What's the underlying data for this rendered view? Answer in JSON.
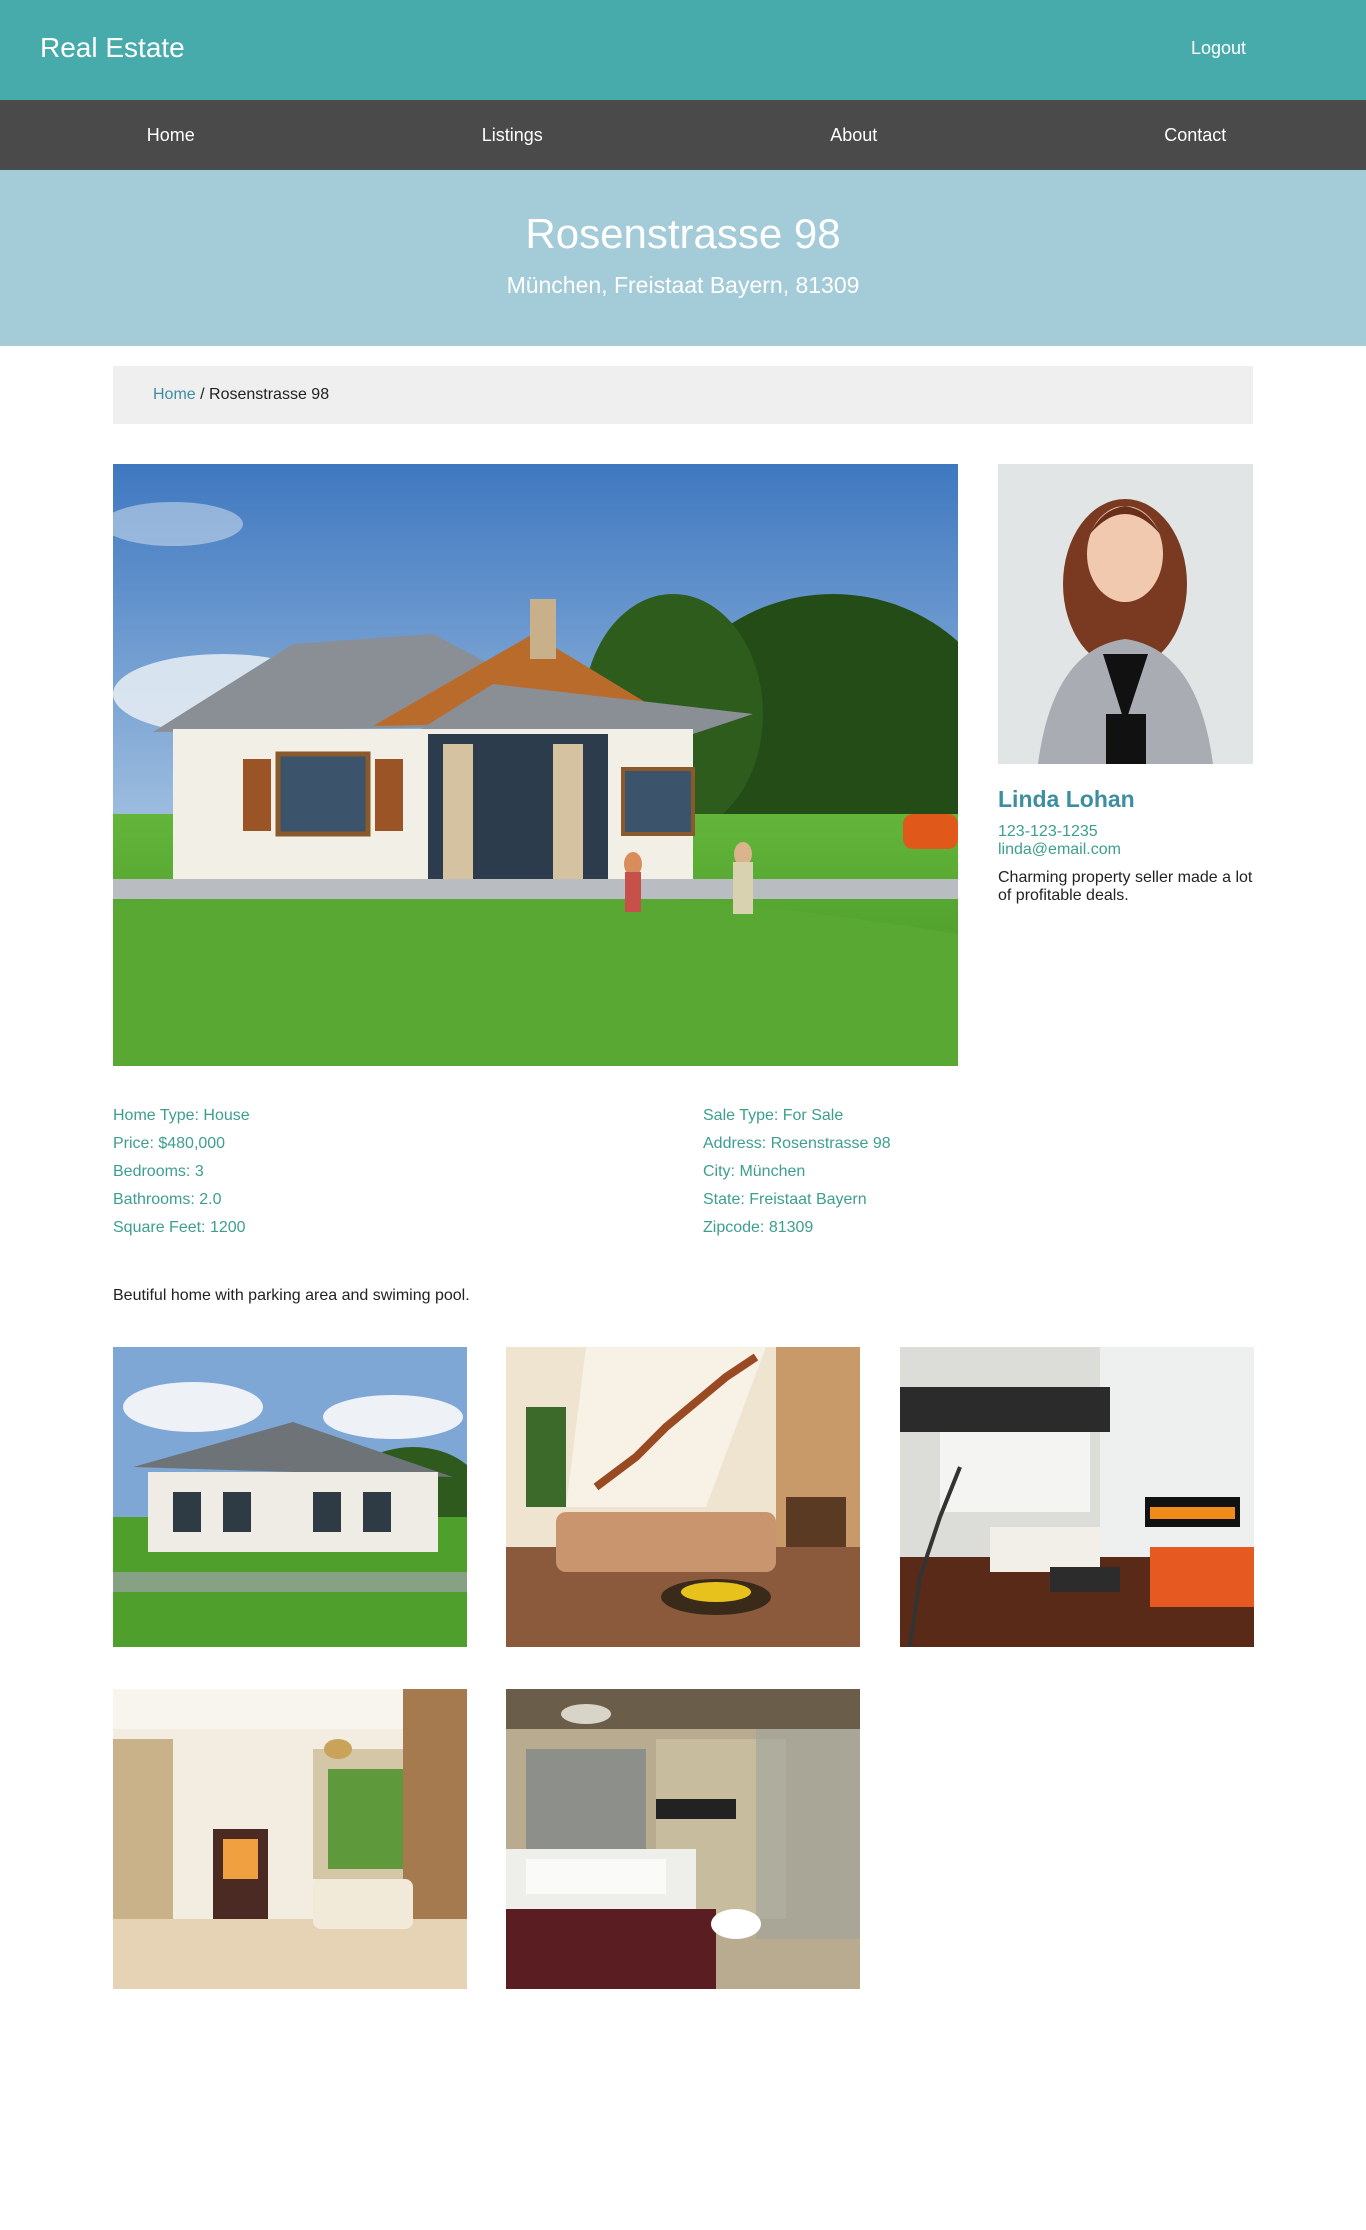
{
  "header": {
    "brand": "Real Estate",
    "logout_label": "Logout"
  },
  "nav": {
    "items": [
      {
        "label": "Home"
      },
      {
        "label": "Listings"
      },
      {
        "label": "About"
      },
      {
        "label": "Contact"
      }
    ]
  },
  "hero": {
    "title": "Rosenstrasse 98",
    "subtitle": "München, Freistaat Bayern, 81309"
  },
  "breadcrumb": {
    "home": "Home",
    "separator": " / ",
    "current": "Rosenstrasse 98"
  },
  "agent": {
    "name": "Linda Lohan",
    "phone": "123-123-1235",
    "email": "linda@email.com",
    "bio": "Charming property seller made a lot of profitable deals."
  },
  "details": {
    "left": [
      "Home Type: House",
      "Price: $480,000",
      "Bedrooms: 3",
      "Bathrooms: 2.0",
      "Square Feet: 1200"
    ],
    "right": [
      "Sale Type: For Sale",
      "Address: Rosenstrasse 98",
      "City: München",
      "State: Freistaat Bayern",
      "Zipcode: 81309"
    ]
  },
  "description": "Beutiful home with parking area and swiming pool.",
  "colors": {
    "topbar": "#47abab",
    "navbar": "#4a4a4a",
    "hero": "#a3cbd8",
    "link": "#3d8ea0",
    "detail_text": "#3d9e90"
  }
}
